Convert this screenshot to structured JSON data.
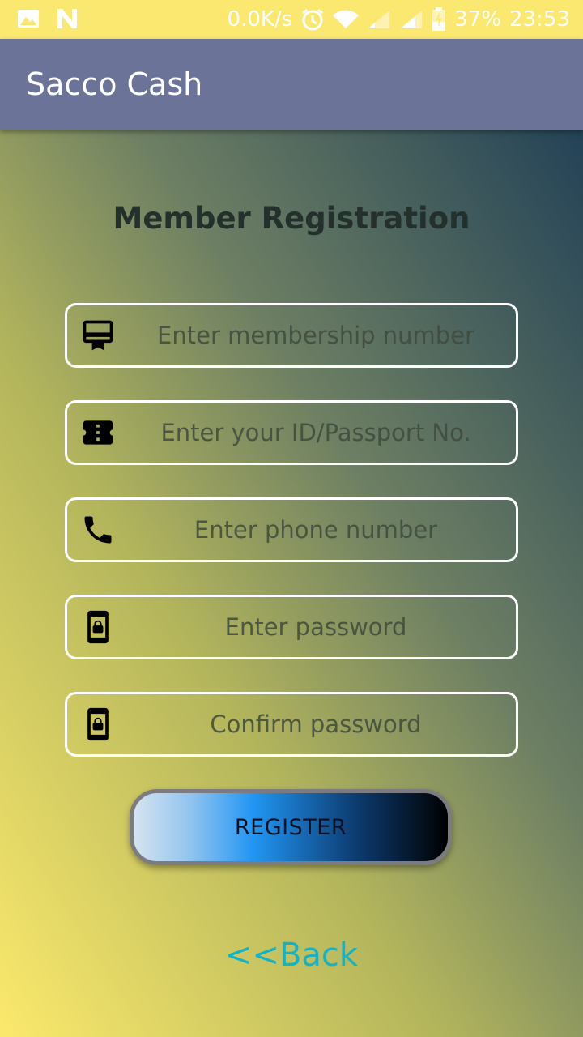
{
  "status_bar": {
    "network_speed": "0.0K/s",
    "battery": "37%",
    "time": "23:53"
  },
  "app_bar": {
    "title": "Sacco Cash"
  },
  "form": {
    "heading": "Member Registration",
    "fields": [
      {
        "icon": "card-membership-icon",
        "placeholder": "Enter membership number"
      },
      {
        "icon": "ticket-icon",
        "placeholder": "Enter your ID/Passport No."
      },
      {
        "icon": "phone-icon",
        "placeholder": "Enter phone number"
      },
      {
        "icon": "phone-lock-icon",
        "placeholder": "Enter password"
      },
      {
        "icon": "phone-lock-icon",
        "placeholder": "Confirm password"
      }
    ],
    "register_label": "REGISTER",
    "back_label": "<<Back"
  }
}
